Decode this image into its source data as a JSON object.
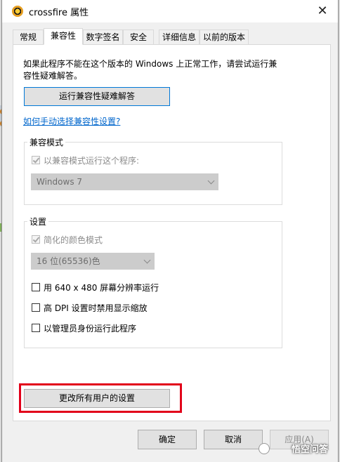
{
  "window": {
    "title": "crossfire 属性",
    "close_icon": "close-icon",
    "app_icon": "crossfire-app-icon"
  },
  "tabs": [
    {
      "label": "常规",
      "active": false
    },
    {
      "label": "兼容性",
      "active": true
    },
    {
      "label": "数字签名",
      "active": false
    },
    {
      "label": "安全",
      "active": false
    },
    {
      "label": "详细信息",
      "active": false
    },
    {
      "label": "以前的版本",
      "active": false
    }
  ],
  "compat": {
    "intro_line1": "如果此程序不能在这个版本的 Windows 上正常工作，请尝试运行兼",
    "intro_line2": "容性疑难解答。",
    "troubleshoot_button": "运行兼容性疑难解答",
    "manual_link": "如何手动选择兼容性设置?",
    "mode_group_label": "兼容模式",
    "mode_checkbox_label": "以兼容模式运行这个程序:",
    "mode_checkbox_checked": true,
    "mode_select_value": "Windows 7",
    "settings_group_label": "设置",
    "reduced_color_label": "简化的颜色模式",
    "reduced_color_checked": true,
    "color_select_value": "16 位(65536)色",
    "opt_640_label": "用 640 x 480 屏幕分辨率运行",
    "opt_dpi_label": "高 DPI 设置时禁用显示缩放",
    "opt_admin_label": "以管理员身份运行此程序",
    "all_users_button": "更改所有用户的设置"
  },
  "footer": {
    "ok": "确定",
    "cancel": "取消",
    "apply": "应用(A)"
  },
  "watermark": {
    "text": "悟空问答"
  },
  "colors": {
    "highlight": "#e2001a",
    "link": "#0066cc",
    "primary_button_border": "#0078d7"
  }
}
